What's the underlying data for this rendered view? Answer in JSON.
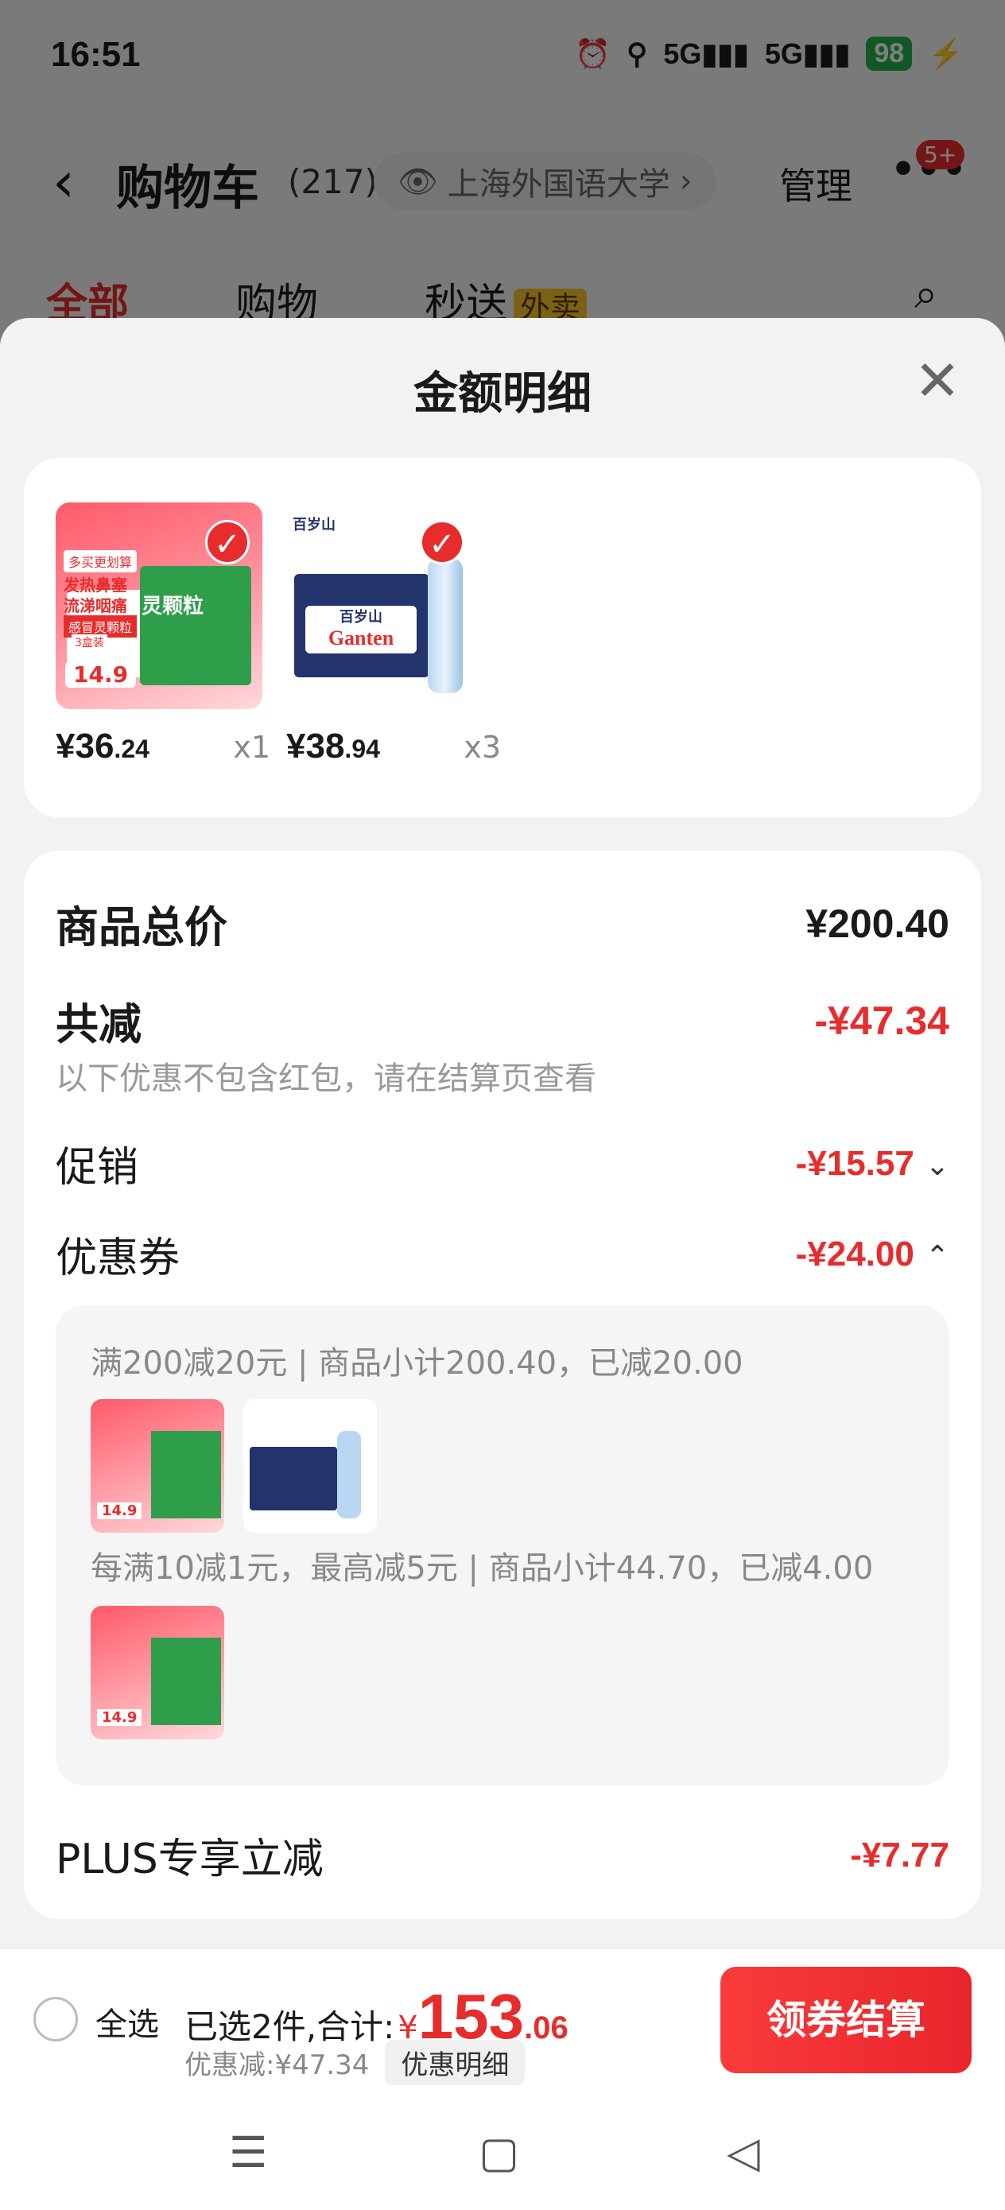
{
  "status_bar": {
    "time": "16:51",
    "net1": "5G",
    "net2": "5G",
    "battery": "98",
    "icons": [
      "alarm-icon",
      "location-icon",
      "signal-icon",
      "signal-icon",
      "battery-icon",
      "charging-icon"
    ]
  },
  "header": {
    "title": "购物车",
    "count": "(217)",
    "location": "上海外国语大学",
    "manage_label": "管理",
    "more_badge": "5+"
  },
  "tabs": [
    {
      "label": "全部"
    },
    {
      "label": "购物"
    },
    {
      "label": "秒送"
    }
  ],
  "tab_tag": "外卖",
  "sheet": {
    "title": "金额明细",
    "products": [
      {
        "price_main": "¥36",
        "price_cents": ".24",
        "qty": "x1"
      },
      {
        "price_main": "¥38",
        "price_cents": ".94",
        "qty": "x3"
      }
    ],
    "total_label": "商品总价",
    "total_value": "¥200.40",
    "reduce_label": "共减",
    "reduce_value": "-¥47.34",
    "reduce_note": "以下优惠不包含红包，请在结算页查看",
    "promo_label": "促销",
    "promo_value": "-¥15.57",
    "coupon_label": "优惠券",
    "coupon_value": "-¥24.00",
    "coupon_line1": "满200减20元 | 商品小计200.40，已减20.00",
    "coupon_line2": "每满10减1元，最高减5元 | 商品小计44.70，已减4.00",
    "plus_label": "PLUS专享立减",
    "plus_value": "-¥7.77"
  },
  "bottom_bar": {
    "select_all": "全选",
    "selected_text": "已选2件,合计:",
    "currency": "¥",
    "total_main": "153",
    "total_cents": ".06",
    "discount_text": "优惠减:¥47.34",
    "detail_button": "优惠明细",
    "checkout_button": "领券结算"
  },
  "product_art": {
    "med_title": "灵颗粒",
    "med_tag": "多买更划算",
    "med_text1": "发热鼻塞",
    "med_text2": "流涕咽痛",
    "med_sub": "感冒灵颗粒",
    "med_box": "3盒装",
    "med_price": "14.9",
    "water_brand": "百岁山",
    "water_logo": "Ganten"
  }
}
